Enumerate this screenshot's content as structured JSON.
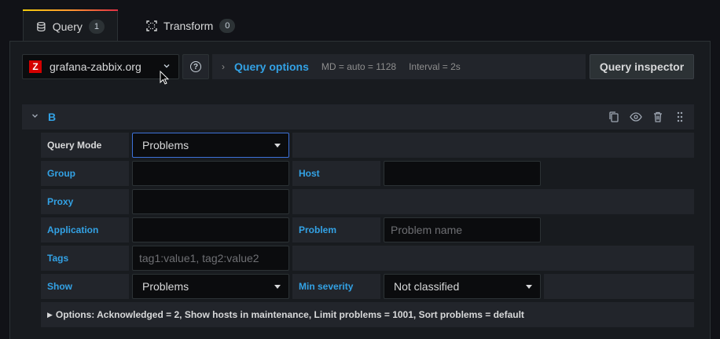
{
  "tabs": [
    {
      "label": "Query",
      "count": "1",
      "icon": "database-icon"
    },
    {
      "label": "Transform",
      "count": "0",
      "icon": "transform-icon"
    }
  ],
  "datasource": {
    "name": "grafana-zabbix.org",
    "logo_letter": "Z",
    "logo_color": "#d40000"
  },
  "query_options": {
    "title": "Query options",
    "md": "MD = auto = 1128",
    "interval": "Interval = 2s"
  },
  "query_inspector": {
    "label": "Query inspector"
  },
  "query": {
    "ref": "B",
    "fields": {
      "query_mode": {
        "label": "Query Mode",
        "value": "Problems"
      },
      "group": {
        "label": "Group",
        "value": ""
      },
      "host": {
        "label": "Host",
        "value": ""
      },
      "proxy": {
        "label": "Proxy",
        "value": ""
      },
      "application": {
        "label": "Application",
        "value": ""
      },
      "problem": {
        "label": "Problem",
        "placeholder": "Problem name"
      },
      "tags": {
        "label": "Tags",
        "placeholder": "tag1:value1, tag2:value2"
      },
      "show": {
        "label": "Show",
        "value": "Problems"
      },
      "min_severity": {
        "label": "Min severity",
        "value": "Not classified"
      }
    },
    "options_summary": "Options: Acknowledged = 2, Show hosts in maintenance, Limit problems = 1001, Sort problems = default"
  },
  "colors": {
    "accent": "#33a2e5",
    "focus": "#3d71d9",
    "background": "#111217"
  }
}
